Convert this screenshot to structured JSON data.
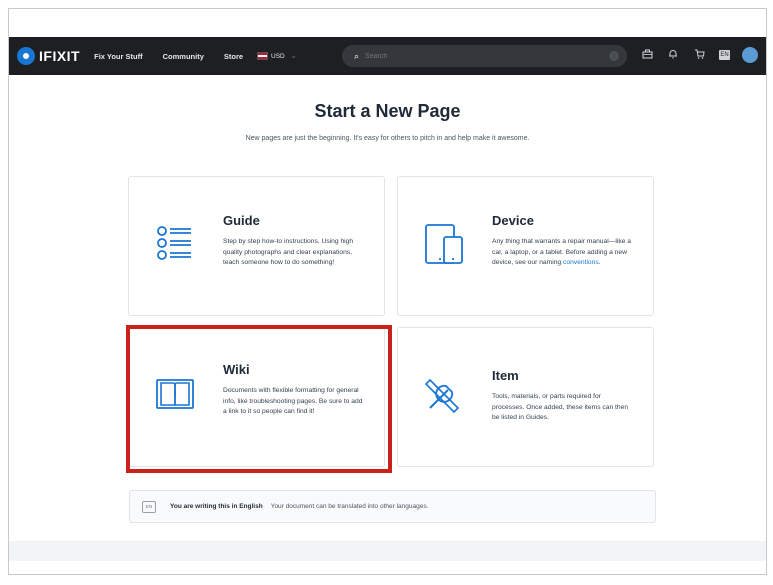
{
  "nav": {
    "logo": "IFIXIT",
    "links": [
      "Fix Your Stuff",
      "Community",
      "Store"
    ],
    "currency": "USD",
    "search_placeholder": "Search",
    "lang_badge": "EN"
  },
  "page": {
    "title": "Start a New Page",
    "subtitle": "New pages are just the beginning. It's easy for others to pitch in and help make it awesome."
  },
  "cards": [
    {
      "title": "Guide",
      "desc": "Step by step how-to instructions. Using high quality photographs and clear explanations, teach someone how to do something!"
    },
    {
      "title": "Device",
      "desc_pre": "Any thing that warrants a repair manual—like a car, a laptop, or a tablet. Before adding a new device, see our naming ",
      "desc_link": "conventions",
      "desc_post": "."
    },
    {
      "title": "Wiki",
      "desc": "Documents with flexible formatting for general info, like troubleshooting pages. Be sure to add a link to it so people can find it!"
    },
    {
      "title": "Item",
      "desc": "Tools, materials, or parts required for processes. Once added, these items can then be listed in Guides."
    }
  ],
  "banner": {
    "icon_text": "EN",
    "bold": "You are writing this in English",
    "text": "Your document can be translated into other languages."
  },
  "colors": {
    "nav_bg": "#1d1f22",
    "link": "#1976d2",
    "highlight": "#c8221a",
    "icon": "#1976d2"
  },
  "icons": [
    "logo-icon",
    "search-icon",
    "toolbox-icon",
    "bell-icon",
    "cart-icon",
    "language-icon",
    "avatar",
    "list-icon",
    "devices-icon",
    "book-icon",
    "tools-icon"
  ]
}
